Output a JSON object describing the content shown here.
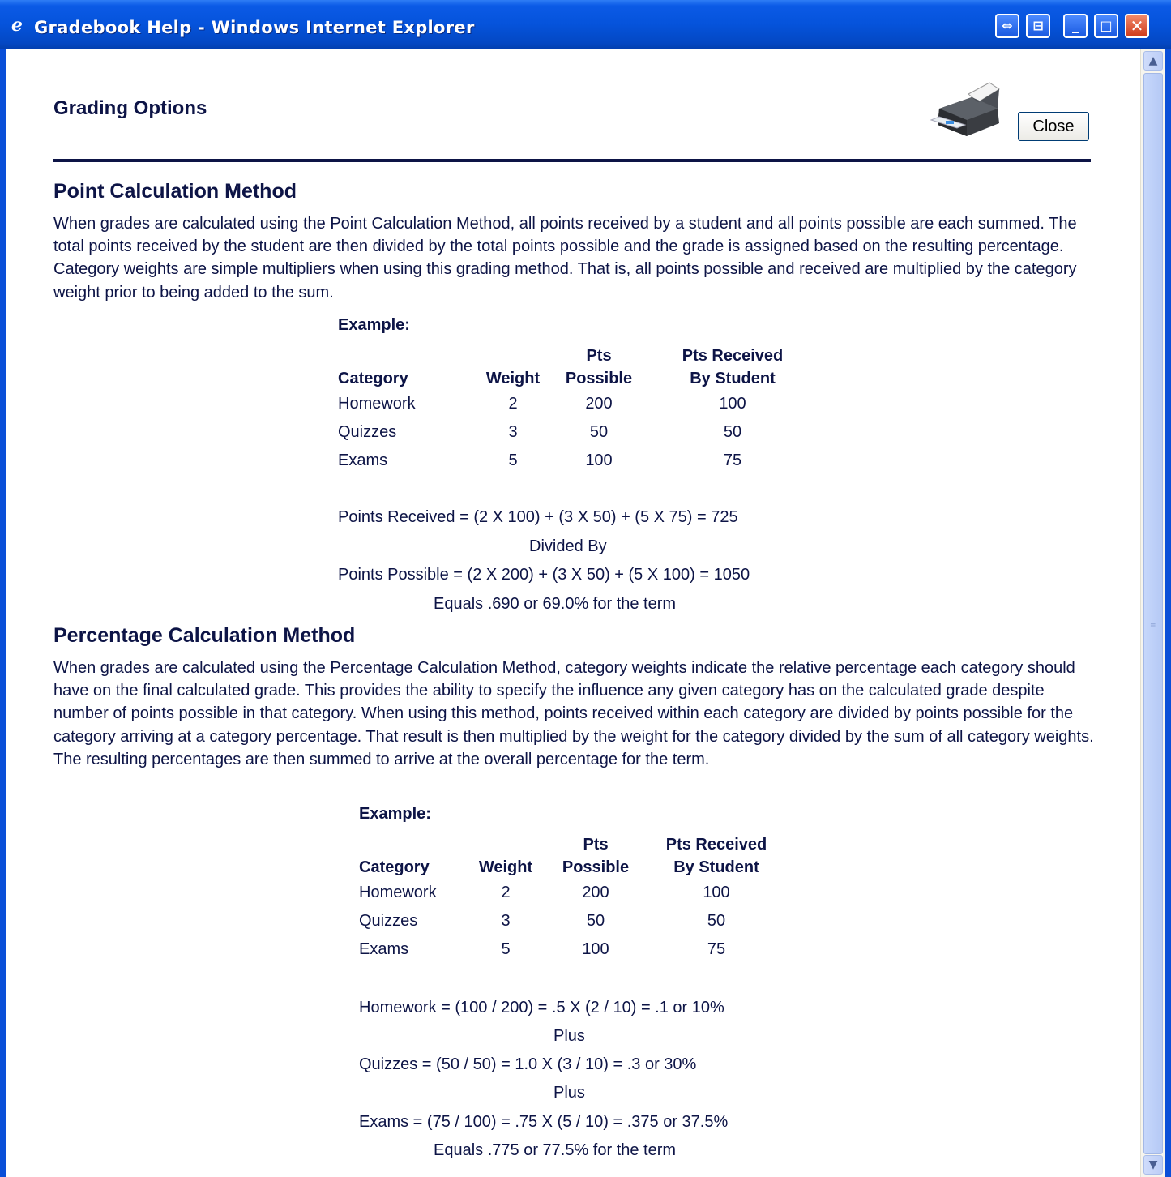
{
  "window": {
    "title": "Gradebook Help - Windows Internet Explorer",
    "icon": "ie-icon",
    "buttons": {
      "restore_glyph": "⇔",
      "tiles_glyph": "⊟",
      "minimize_glyph": "_",
      "maximize_glyph": "□",
      "close_glyph": "✕"
    }
  },
  "header": {
    "title": "Grading Options",
    "close_label": "Close",
    "print_icon": "printer-icon"
  },
  "point_method": {
    "heading": "Point Calculation Method",
    "description": "When grades are calculated using the Point Calculation Method, all points received by a student and all points possible are each summed. The total points received by the student are then divided by the total points possible and the grade is assigned based on the resulting percentage. Category weights are simple multipliers when using this grading method. That is, all points possible and received are multiplied by the category weight prior to being added to the sum.",
    "example_label": "Example:",
    "columns": [
      "Category",
      "Weight",
      "Pts\nPossible",
      "Pts Received\nBy Student"
    ],
    "rows": [
      [
        "Homework",
        "2",
        "200",
        "100"
      ],
      [
        "Quizzes",
        "3",
        "50",
        "50"
      ],
      [
        "Exams",
        "5",
        "100",
        "75"
      ]
    ],
    "calc": [
      "Points Received = (2 X 100) + (3 X 50) + (5 X 75) = 725",
      "Divided By",
      "Points Possible = (2 X 200) + (3 X 50) + (5 X 100) = 1050",
      "Equals .690 or 69.0% for the term"
    ]
  },
  "percentage_method": {
    "heading": "Percentage Calculation Method",
    "description": "When grades are calculated using the Percentage Calculation Method, category weights indicate the relative percentage each category should have on the final calculated grade. This provides the ability to specify the influence any given category has on the calculated grade despite number of points possible in that category. When using this method, points received within each category are divided by points possible for the category arriving at a category percentage. That result is then multiplied by the weight for the category divided by the sum of all category weights. The resulting percentages are then summed to arrive at the overall percentage for the term.",
    "example_label": "Example:",
    "columns": [
      "Category",
      "Weight",
      "Pts\nPossible",
      "Pts Received\nBy Student"
    ],
    "rows": [
      [
        "Homework",
        "2",
        "200",
        "100"
      ],
      [
        "Quizzes",
        "3",
        "50",
        "50"
      ],
      [
        "Exams",
        "5",
        "100",
        "75"
      ]
    ],
    "calc": [
      "Homework = (100 / 200) = .5 X (2 / 10) = .1 or 10%",
      "Plus",
      "Quizzes = (50 / 50) = 1.0 X (3 / 10) = .3 or 30%",
      "Plus",
      "Exams = (75 / 100) = .75 X (5 / 10) = .375 or 37.5%",
      "Equals .775 or 77.5% for the term"
    ]
  },
  "scrollbar": {
    "up_glyph": "▲",
    "down_glyph": "▼",
    "grip_glyph": "≡"
  }
}
